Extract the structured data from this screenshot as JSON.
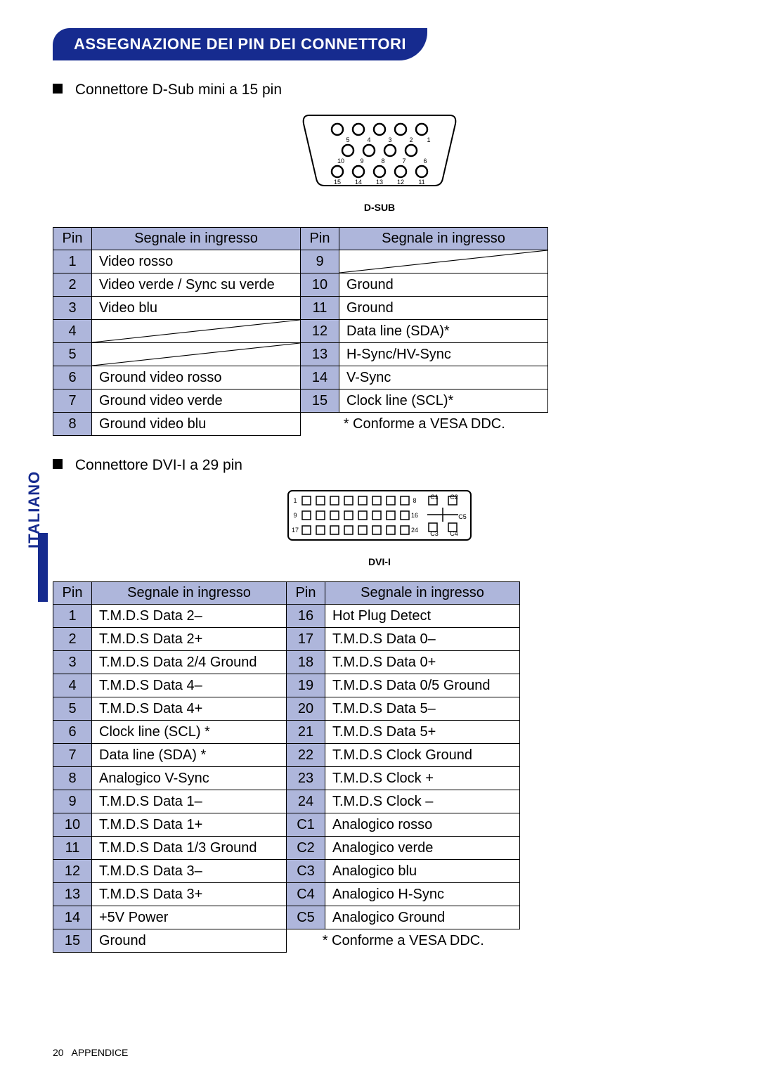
{
  "title": "ASSEGNAZIONE DEI PIN DEI CONNETTORI",
  "side_label": "ITALIANO",
  "footer_page": "20",
  "footer_section": "APPENDICE",
  "sections": {
    "dsub": {
      "heading": "Connettore D-Sub mini a 15 pin",
      "diagram_caption": "D-SUB",
      "headers": {
        "pin": "Pin",
        "signal": "Segnale in ingresso"
      },
      "left": [
        {
          "pin": "1",
          "sig": "Video rosso"
        },
        {
          "pin": "2",
          "sig": "Video verde / Sync su verde"
        },
        {
          "pin": "3",
          "sig": "Video blu"
        },
        {
          "pin": "4",
          "sig": ""
        },
        {
          "pin": "5",
          "sig": ""
        },
        {
          "pin": "6",
          "sig": "Ground video rosso"
        },
        {
          "pin": "7",
          "sig": "Ground video verde"
        },
        {
          "pin": "8",
          "sig": "Ground video blu"
        }
      ],
      "right": [
        {
          "pin": "9",
          "sig": ""
        },
        {
          "pin": "10",
          "sig": "Ground"
        },
        {
          "pin": "11",
          "sig": "Ground"
        },
        {
          "pin": "12",
          "sig": "Data line (SDA)*"
        },
        {
          "pin": "13",
          "sig": "H-Sync/HV-Sync"
        },
        {
          "pin": "14",
          "sig": "V-Sync"
        },
        {
          "pin": "15",
          "sig": "Clock line (SCL)*"
        }
      ],
      "note": "* Conforme a VESA DDC."
    },
    "dvi": {
      "heading": "Connettore DVI-I a 29 pin",
      "diagram_caption": "DVI-I",
      "headers": {
        "pin": "Pin",
        "signal": "Segnale in ingresso"
      },
      "left": [
        {
          "pin": "1",
          "sig": "T.M.D.S Data 2–"
        },
        {
          "pin": "2",
          "sig": "T.M.D.S Data 2+"
        },
        {
          "pin": "3",
          "sig": "T.M.D.S Data 2/4 Ground"
        },
        {
          "pin": "4",
          "sig": "T.M.D.S Data 4–"
        },
        {
          "pin": "5",
          "sig": "T.M.D.S Data 4+"
        },
        {
          "pin": "6",
          "sig": "Clock line (SCL) *"
        },
        {
          "pin": "7",
          "sig": "Data line (SDA) *"
        },
        {
          "pin": "8",
          "sig": "Analogico V-Sync"
        },
        {
          "pin": "9",
          "sig": "T.M.D.S Data 1–"
        },
        {
          "pin": "10",
          "sig": "T.M.D.S Data 1+"
        },
        {
          "pin": "11",
          "sig": "T.M.D.S Data 1/3 Ground"
        },
        {
          "pin": "12",
          "sig": "T.M.D.S Data 3–"
        },
        {
          "pin": "13",
          "sig": "T.M.D.S Data 3+"
        },
        {
          "pin": "14",
          "sig": "+5V Power"
        },
        {
          "pin": "15",
          "sig": "Ground"
        }
      ],
      "right": [
        {
          "pin": "16",
          "sig": "Hot Plug Detect"
        },
        {
          "pin": "17",
          "sig": "T.M.D.S Data 0–"
        },
        {
          "pin": "18",
          "sig": "T.M.D.S Data 0+"
        },
        {
          "pin": "19",
          "sig": "T.M.D.S Data 0/5 Ground"
        },
        {
          "pin": "20",
          "sig": "T.M.D.S Data 5–"
        },
        {
          "pin": "21",
          "sig": "T.M.D.S Data 5+"
        },
        {
          "pin": "22",
          "sig": "T.M.D.S Clock Ground"
        },
        {
          "pin": "23",
          "sig": "T.M.D.S Clock +"
        },
        {
          "pin": "24",
          "sig": "T.M.D.S Clock –"
        },
        {
          "pin": "C1",
          "sig": "Analogico rosso"
        },
        {
          "pin": "C2",
          "sig": "Analogico verde"
        },
        {
          "pin": "C3",
          "sig": "Analogico blu"
        },
        {
          "pin": "C4",
          "sig": "Analogico H-Sync"
        },
        {
          "pin": "C5",
          "sig": "Analogico Ground"
        }
      ],
      "note": "* Conforme a VESA DDC."
    }
  }
}
